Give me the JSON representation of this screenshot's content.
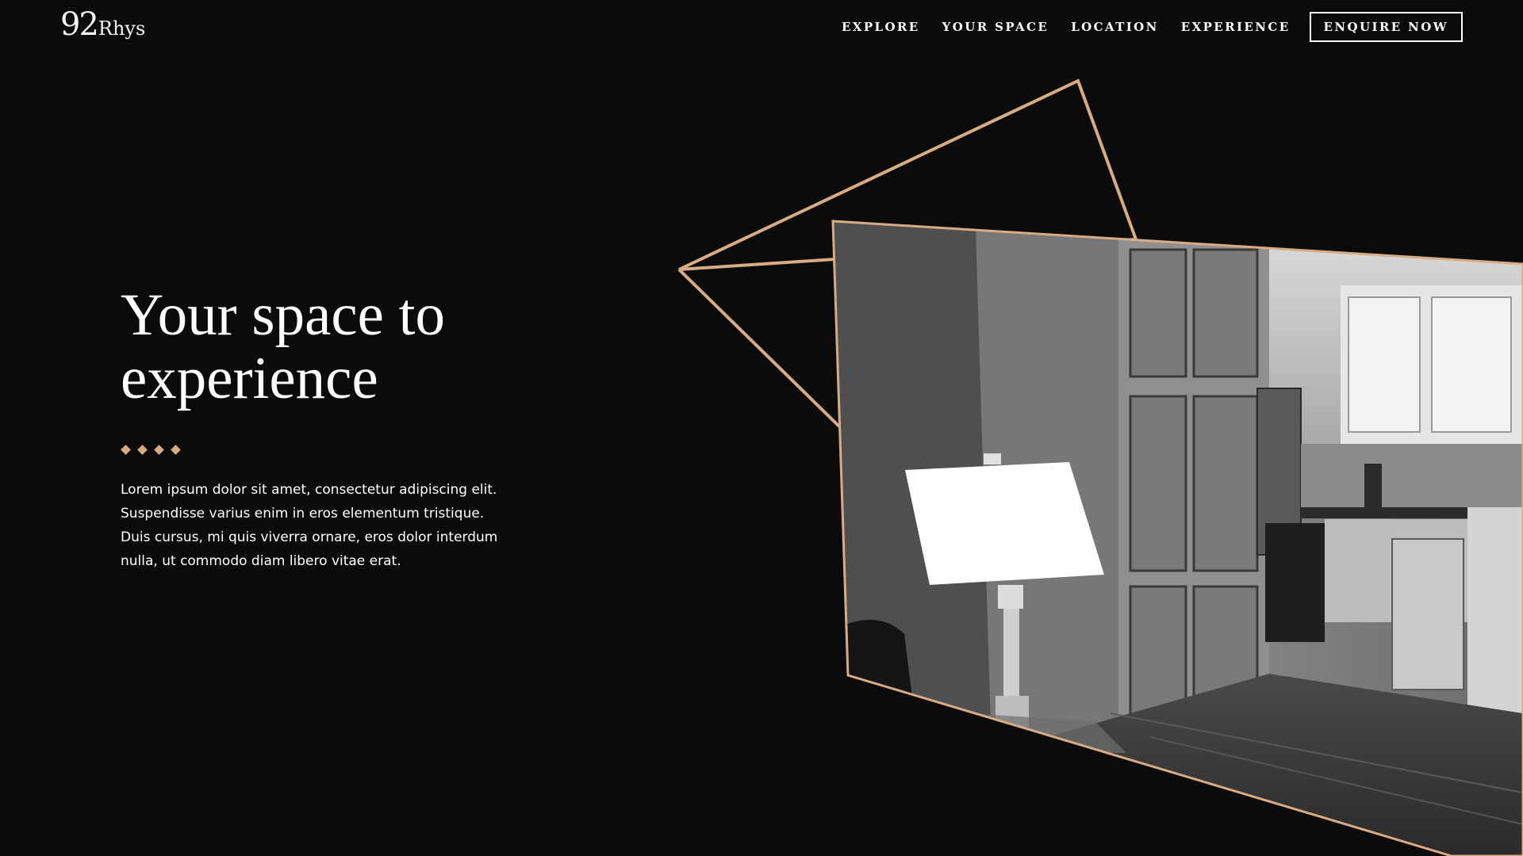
{
  "logo": {
    "number": "92",
    "name": "Rhys"
  },
  "nav": {
    "items": [
      {
        "label": "EXPLORE"
      },
      {
        "label": "YOUR SPACE"
      },
      {
        "label": "LOCATION"
      },
      {
        "label": "EXPERIENCE"
      }
    ],
    "cta_label": "ENQUIRE NOW"
  },
  "hero": {
    "title_line_1": "Your space to",
    "title_line_2": "experience",
    "body": "Lorem ipsum dolor sit amet, consectetur adipiscing elit. Suspendisse varius enim in eros elementum tristique. Duis cursus, mi quis viverra ornare, eros dolor interdum nulla, ut commodo diam libero vitae erat."
  },
  "colors": {
    "background": "#0b0b0c",
    "accent": "#d9ab82",
    "text": "#ffffff"
  }
}
